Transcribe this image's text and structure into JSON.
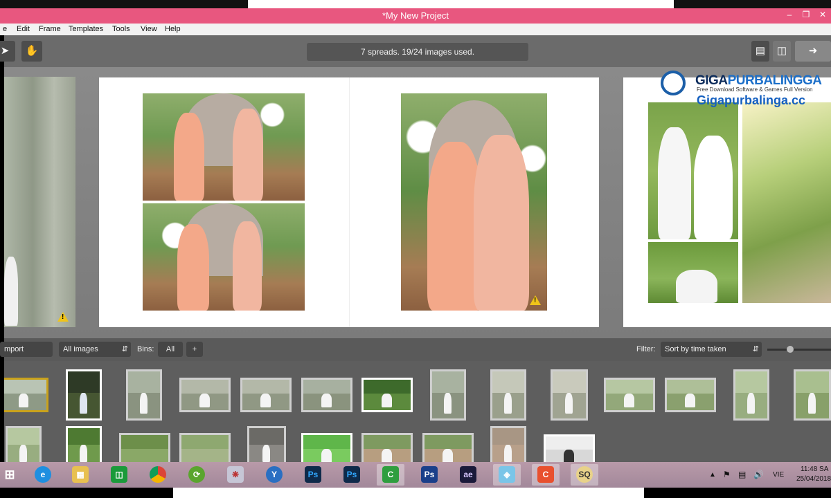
{
  "window": {
    "title": "*My New Project"
  },
  "menu": [
    "e",
    "Edit",
    "Frame",
    "Templates",
    "Tools",
    "View",
    "Help"
  ],
  "toolbar": {
    "status": "7 spreads. 19/24 images used."
  },
  "watermark": {
    "brand_a": "GIGA",
    "brand_b": "PURBALINGGA",
    "tagline": "Free Download Software & Games Full Version",
    "url": "Gigapurbalinga.cc"
  },
  "binbar": {
    "import_label": "mport Images",
    "images_select": "All images",
    "bins_label": "Bins:",
    "bins_all": "All",
    "bins_add": "+",
    "filter_label": "Filter:",
    "sort_select": "Sort by time taken"
  },
  "tray": {
    "lang": "VIE",
    "time": "11:48 SA",
    "date": "25/04/2018"
  },
  "taskbar_apps": [
    "windows-start",
    "internet-explorer",
    "file-explorer",
    "store",
    "chrome",
    "app-green",
    "app-pink",
    "app-ys",
    "photoshop",
    "photoshop-2",
    "camtasia",
    "photoshop-3",
    "after-effects",
    "app-blue",
    "camtasia-recorder",
    "app-sq"
  ],
  "colors": {
    "title_bar": "#e8577f",
    "warning": "#f0c419"
  }
}
